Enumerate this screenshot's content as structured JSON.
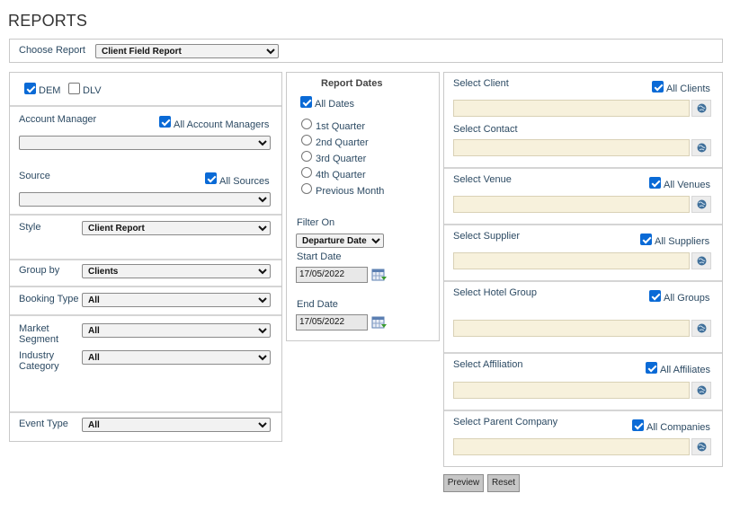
{
  "page": {
    "title": "REPORTS"
  },
  "choose_report": {
    "label": "Choose Report",
    "value": "Client Field Report"
  },
  "left": {
    "dem": {
      "label": "DEM",
      "checked": true
    },
    "dlv": {
      "label": "DLV",
      "checked": false
    },
    "account_manager": {
      "label": "Account Manager",
      "all_label": "All Account Managers",
      "value": ""
    },
    "source": {
      "label": "Source",
      "all_label": "All Sources",
      "value": ""
    },
    "style": {
      "label": "Style",
      "value": "Client Report"
    },
    "group_by": {
      "label": "Group by",
      "value": "Clients"
    },
    "booking_type": {
      "label": "Booking Type",
      "value": "All"
    },
    "market_segment": {
      "label_line1": "Market",
      "label_line2": "Segment",
      "value": "All"
    },
    "industry_category": {
      "label_line1": "Industry",
      "label_line2": "Category",
      "value": "All"
    },
    "event_type": {
      "label": "Event Type",
      "value": "All"
    }
  },
  "middle": {
    "heading": "Report Dates",
    "all_dates": "All Dates",
    "quarters": [
      "1st Quarter",
      "2nd Quarter",
      "3rd Quarter",
      "4th Quarter",
      "Previous Month"
    ],
    "filter_on": {
      "label": "Filter On",
      "value": "Departure Date"
    },
    "start_date": {
      "label": "Start Date",
      "value": "17/05/2022"
    },
    "end_date": {
      "label": "End Date",
      "value": "17/05/2022"
    }
  },
  "right": {
    "client": {
      "label": "Select Client",
      "all_label": "All Clients"
    },
    "contact": {
      "label": "Select Contact"
    },
    "venue": {
      "label": "Select Venue",
      "all_label": "All Venues"
    },
    "supplier": {
      "label": "Select Supplier",
      "all_label": "All Suppliers"
    },
    "hotel_group": {
      "label": "Select Hotel Group",
      "all_label": "All Groups"
    },
    "affiliation": {
      "label": "Select Affiliation",
      "all_label": "All Affiliates"
    },
    "parent_company": {
      "label": "Select Parent Company",
      "all_label": "All Companies"
    }
  },
  "buttons": {
    "preview": "Preview",
    "reset": "Reset"
  },
  "icons": {
    "lookup": "globe-icon",
    "calendar": "calendar-icon"
  }
}
